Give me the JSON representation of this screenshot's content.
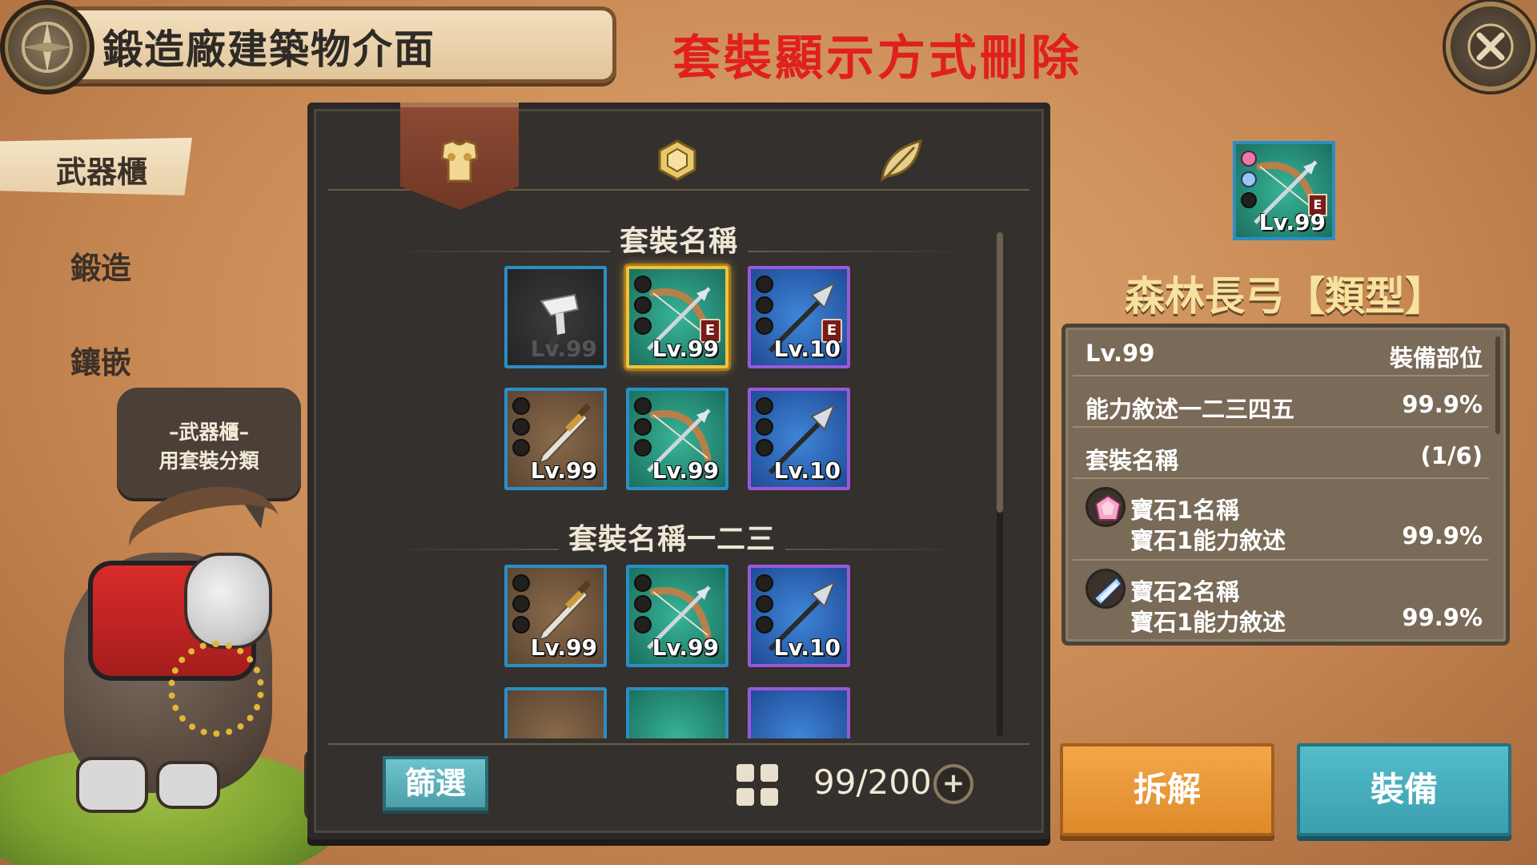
{
  "header": {
    "title": "鍛造廠建築物介面",
    "annotation": "套裝顯示方式刪除"
  },
  "left_tabs": [
    {
      "label": "武器櫃",
      "active": true
    },
    {
      "label": "鍛造",
      "active": false
    },
    {
      "label": "鑲嵌",
      "active": false
    }
  ],
  "speech": {
    "line1": "–武器櫃–",
    "line2": "用套裝分類"
  },
  "category_tabs": [
    {
      "icon": "armor-icon",
      "active": true
    },
    {
      "icon": "gem-icon",
      "active": false
    },
    {
      "icon": "leaf-icon",
      "active": false
    }
  ],
  "inventory": {
    "sets": [
      {
        "name": "套裝名稱",
        "items": [
          {
            "type": "hammer",
            "level": "Lv.99",
            "frame": "blue",
            "bg": "dark",
            "locked": true
          },
          {
            "type": "bow",
            "level": "Lv.99",
            "frame": "gold",
            "bg": "green",
            "selected": true,
            "equipped": "E"
          },
          {
            "type": "spear",
            "level": "Lv.10",
            "frame": "purple",
            "bg": "blue",
            "equipped": "E"
          },
          {
            "type": "sword",
            "level": "Lv.99",
            "frame": "blue",
            "bg": "brown"
          },
          {
            "type": "bow",
            "level": "Lv.99",
            "frame": "blue",
            "bg": "green"
          },
          {
            "type": "spear",
            "level": "Lv.10",
            "frame": "purple",
            "bg": "blue"
          }
        ]
      },
      {
        "name": "套裝名稱一二三",
        "items": [
          {
            "type": "sword",
            "level": "Lv.99",
            "frame": "blue",
            "bg": "brown"
          },
          {
            "type": "bow",
            "level": "Lv.99",
            "frame": "blue",
            "bg": "green"
          },
          {
            "type": "spear",
            "level": "Lv.10",
            "frame": "purple",
            "bg": "blue"
          }
        ]
      }
    ],
    "filter_label": "篩選",
    "count": "99/200",
    "add_label": "+"
  },
  "detail": {
    "icon_level": "Lv.99",
    "icon_badge": "E",
    "name": "森林長弓【類型】",
    "rows": {
      "level": "Lv.99",
      "slot": "裝備部位",
      "ability": "能力敘述一二三四五",
      "ability_val": "99.9%",
      "set": "套裝名稱",
      "set_val": "(1/6)",
      "gem1_name": "寶石1名稱",
      "gem1_desc": "寶石1能力敘述",
      "gem1_val": "99.9%",
      "gem2_name": "寶石2名稱",
      "gem2_desc": "寶石1能力敘述",
      "gem2_val": "99.9%"
    }
  },
  "buttons": {
    "dismantle": "拆解",
    "equip": "裝備"
  },
  "colors": {
    "annotation_red": "#e0201f",
    "frame_blue": "#2a8ec6",
    "frame_gold": "#f3c23d",
    "frame_purple": "#9b58d8",
    "item_name_gold": "#f7e2a0",
    "equip_btn": "#54bccb",
    "dismantle_btn": "#f3a74a"
  }
}
